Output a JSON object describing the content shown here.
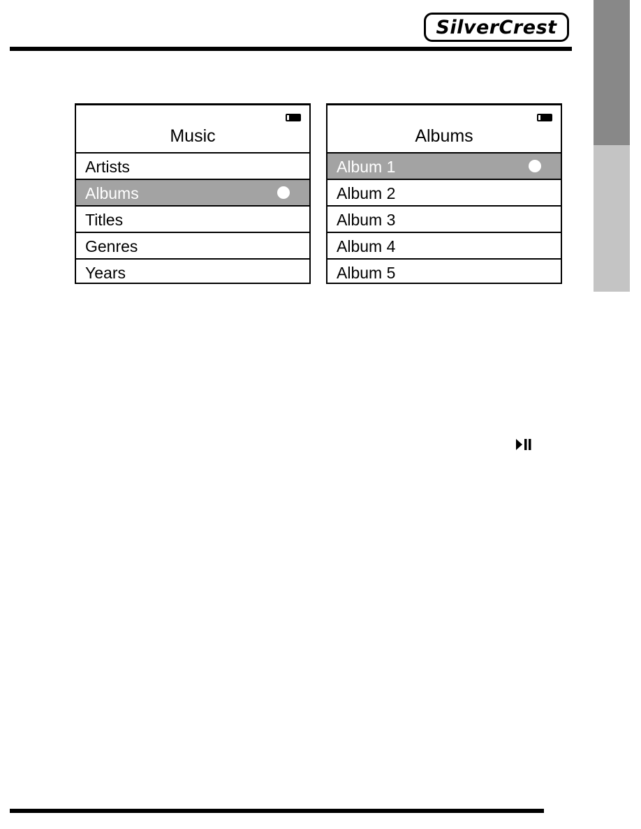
{
  "brand": {
    "logo_text": "SilverCrest"
  },
  "screens": [
    {
      "title": "Music",
      "items": [
        {
          "label": "Artists",
          "selected": false
        },
        {
          "label": "Albums",
          "selected": true
        },
        {
          "label": "Titles",
          "selected": false
        },
        {
          "label": "Genres",
          "selected": false
        },
        {
          "label": "Years",
          "selected": false
        }
      ]
    },
    {
      "title": "Albums",
      "items": [
        {
          "label": "Album 1",
          "selected": true
        },
        {
          "label": "Album 2",
          "selected": false
        },
        {
          "label": "Album 3",
          "selected": false
        },
        {
          "label": "Album 4",
          "selected": false
        },
        {
          "label": "Album 5",
          "selected": false
        }
      ]
    }
  ],
  "icons": {
    "battery": "battery-icon",
    "selection": "circle-icon",
    "play_pause": "play-pause-icon"
  },
  "colors": {
    "highlight": "#a3a3a3",
    "tab_dark": "#888888",
    "tab_light": "#c4c4c4"
  }
}
